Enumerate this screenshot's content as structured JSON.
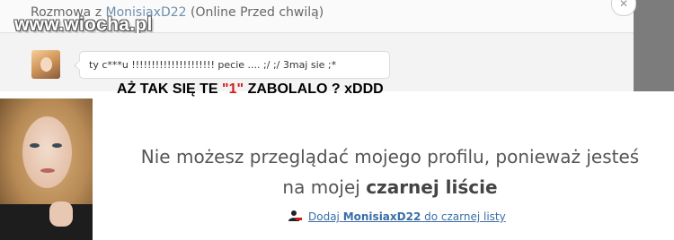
{
  "watermark": "www.wiocha.pl",
  "chat": {
    "title_prefix": "Rozmowa z",
    "username": "MonisiaxD22",
    "status": "(Online Przed chwilą)",
    "close_symbol": "✕",
    "message": "ty c***u !!!!!!!!!!!!!!!!!!!!! pecie .... ;/ ;/ 3maj sie ;*"
  },
  "caption": {
    "before": "AŻ TAK SIĘ TE ",
    "highlight": "\"1\"",
    "after": " ZABOLALO ? xDDD"
  },
  "profile": {
    "line1": "Nie możesz przeglądać mojego profilu, ponieważ jesteś",
    "line2_prefix": "na mojej ",
    "line2_bold": "czarnej liście",
    "link_prefix": "Dodaj ",
    "link_user": "MonisiaxD22",
    "link_suffix": " do czarnej listy",
    "link_icon": "user-block-icon"
  },
  "colors": {
    "link": "#3b6ea5",
    "highlight": "#d11a1a"
  }
}
